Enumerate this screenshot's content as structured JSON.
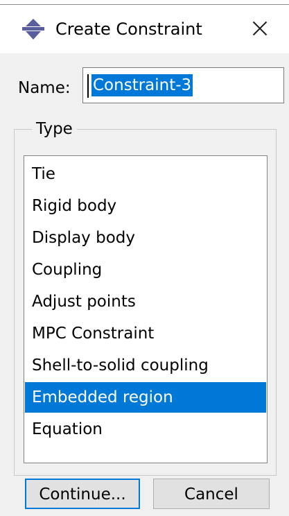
{
  "dialog": {
    "title": "Create Constraint",
    "icon": "create-constraint-icon",
    "close_icon": "close-icon"
  },
  "name_field": {
    "label": "Name:",
    "value": "Constraint-3",
    "text_selected": true
  },
  "type_group": {
    "legend": "Type",
    "items": [
      "Tie",
      "Rigid body",
      "Display body",
      "Coupling",
      "Adjust points",
      "MPC Constraint",
      "Shell-to-solid coupling",
      "Embedded region",
      "Equation"
    ],
    "selected": "Embedded region"
  },
  "buttons": {
    "continue_label": "Continue...",
    "cancel_label": "Cancel"
  },
  "colors": {
    "selection": "#0078d7",
    "dialog_background": "#f0f0f0",
    "icon_purple": "#5b5e9d"
  }
}
